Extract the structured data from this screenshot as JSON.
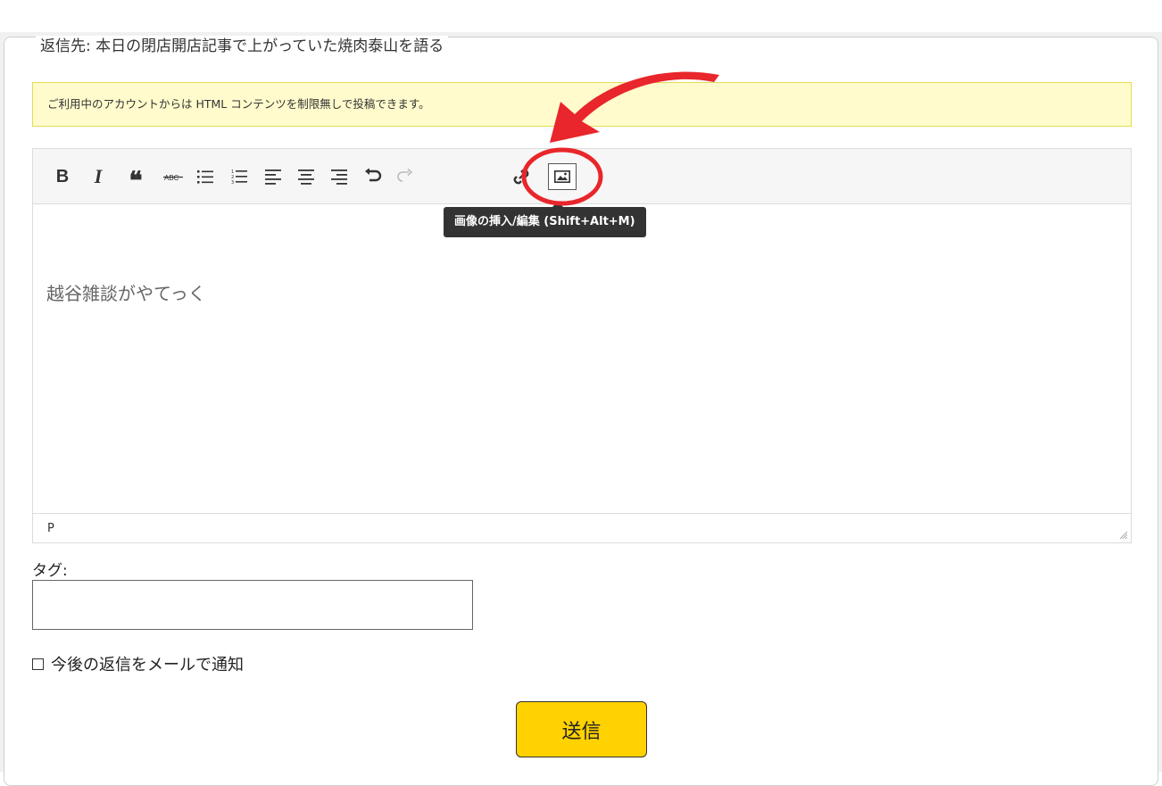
{
  "form": {
    "legend": "返信先: 本日の閉店開店記事で上がっていた焼肉泰山を語る",
    "notice": "ご利用中のアカウントからは HTML コンテンツを制限無しで投稿できます。",
    "editor": {
      "content": "越谷雑談がやてっく",
      "status_path": "P",
      "tooltip": "画像の挿入/編集 (Shift+Alt+M)",
      "toolbar": [
        {
          "name": "bold",
          "icon": "bold-icon",
          "glyph": "B"
        },
        {
          "name": "italic",
          "icon": "italic-icon",
          "glyph": "I"
        },
        {
          "name": "blockquote",
          "icon": "blockquote-icon",
          "glyph": "❝"
        },
        {
          "name": "strikethrough",
          "icon": "strikethrough-icon",
          "glyph": "ABC"
        },
        {
          "name": "bullet-list",
          "icon": "bullet-list-icon"
        },
        {
          "name": "numbered-list",
          "icon": "numbered-list-icon"
        },
        {
          "name": "align-left",
          "icon": "align-left-icon"
        },
        {
          "name": "align-center",
          "icon": "align-center-icon"
        },
        {
          "name": "align-right",
          "icon": "align-right-icon"
        },
        {
          "name": "undo",
          "icon": "undo-icon"
        },
        {
          "name": "redo",
          "icon": "redo-icon"
        },
        {
          "name": "link",
          "icon": "link-icon"
        },
        {
          "name": "insert-image",
          "icon": "image-icon"
        }
      ]
    },
    "tags_label": "タグ:",
    "tags_value": "",
    "notify_label": "今後の返信をメールで通知",
    "notify_checked": false,
    "submit_label": "送信"
  },
  "annotation": {
    "arrow_color": "#e8262b",
    "circle_color": "#e8262b"
  }
}
